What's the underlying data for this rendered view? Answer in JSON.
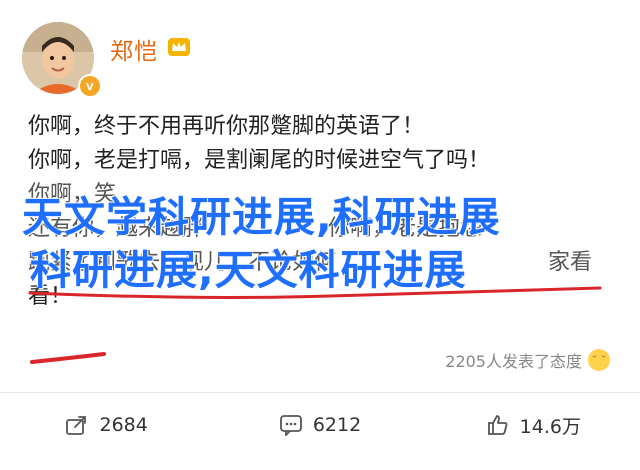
{
  "user": {
    "name": "郑恺"
  },
  "post": {
    "lines": [
      "你啊，终于不用再听你那蹩脚的英语了！",
      "你啊，老是打嗝，是割阑尾的时候进空气了吗！",
      "你啊，笑"
    ],
    "hidden_fragments": [
      "还有你，越来越胖",
      "你啊，老是抱怨",
      "跑紧了别歌去，现儿，不论如何",
      "家看",
      "看！"
    ],
    "meta": "2205人发表了态度"
  },
  "watermark": {
    "line1": "天文学科研进展,科研进展",
    "line2": "科研进展,天文科研进展"
  },
  "actions": {
    "share": "2684",
    "comment": "6212",
    "like": "14.6万"
  },
  "colors": {
    "username": "#e4680f",
    "watermark": "#1e6eff",
    "underline": "#d9262b"
  }
}
